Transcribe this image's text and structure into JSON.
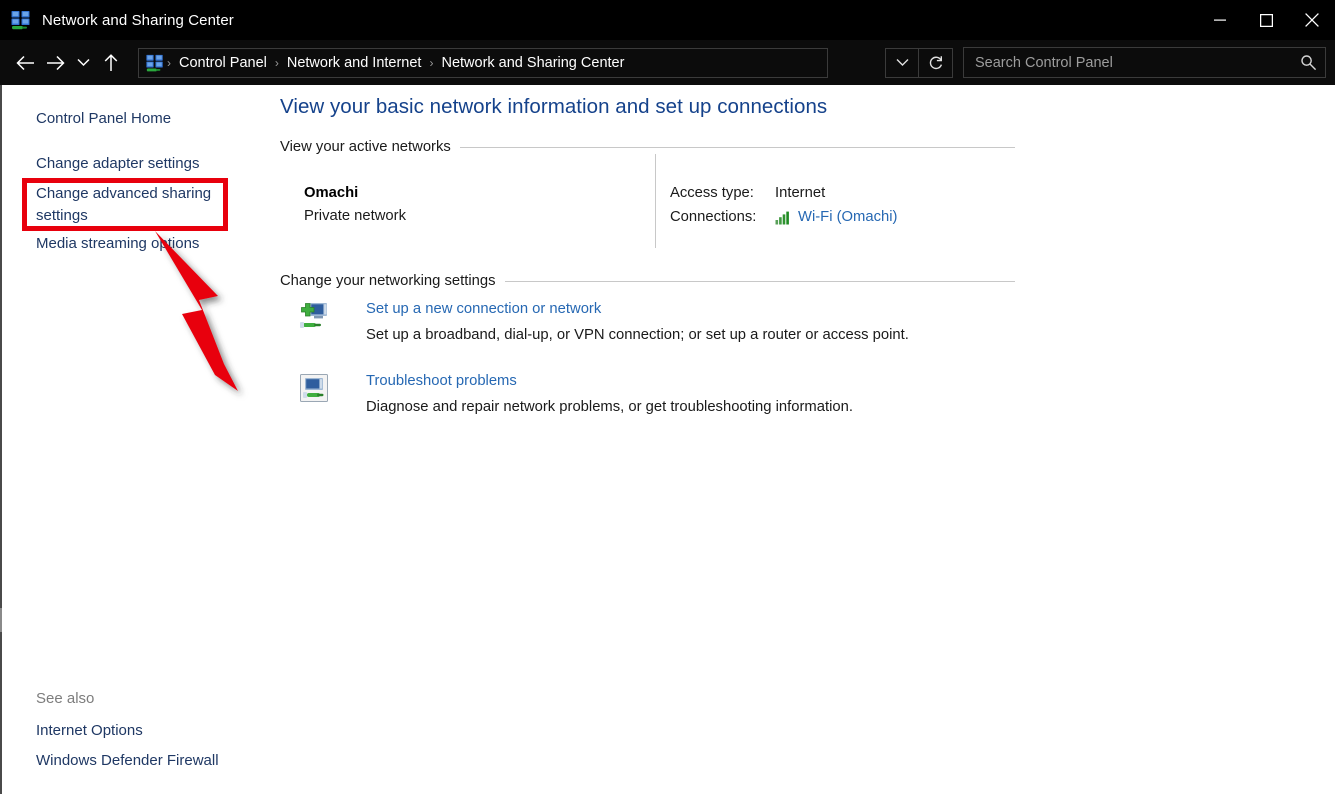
{
  "window": {
    "title": "Network and Sharing Center",
    "icon": "network-computers-icon",
    "controls": {
      "minimize": "minimize-icon",
      "maximize": "maximize-icon",
      "close": "close-icon"
    }
  },
  "addressbar": {
    "back": "back-arrow-icon",
    "forward": "forward-arrow-icon",
    "recent": "chevron-down-icon",
    "up": "up-arrow-icon",
    "crumb_icon": "control-panel-icon",
    "breadcrumbs": [
      "Control Panel",
      "Network and Internet",
      "Network and Sharing Center"
    ],
    "separator": "›",
    "history_dropdown": "chevron-down-icon",
    "refresh": "refresh-icon",
    "search": {
      "placeholder": "Search Control Panel",
      "value": "",
      "icon": "search-icon"
    }
  },
  "sidebar": {
    "items": [
      {
        "label": "Control Panel Home"
      },
      {
        "label": "Change adapter settings"
      },
      {
        "label": "Change advanced sharing settings"
      },
      {
        "label": "Media streaming options"
      }
    ],
    "see_also": {
      "label": "See also",
      "items": [
        {
          "label": "Internet Options"
        },
        {
          "label": "Windows Defender Firewall"
        }
      ]
    }
  },
  "main": {
    "page_title": "View your basic network information and set up connections",
    "active_networks": {
      "heading": "View your active networks",
      "network": {
        "name": "Omachi",
        "type": "Private network",
        "access_type_key": "Access type:",
        "access_type_value": "Internet",
        "connections_key": "Connections:",
        "connections_value": "Wi-Fi (Omachi)",
        "connections_icon": "wifi-signal-bars-icon"
      }
    },
    "networking_settings": {
      "heading": "Change your networking settings",
      "tasks": [
        {
          "icon": "new-connection-icon",
          "link": "Set up a new connection or network",
          "description": "Set up a broadband, dial-up, or VPN connection; or set up a router or access point."
        },
        {
          "icon": "troubleshoot-icon",
          "link": "Troubleshoot problems",
          "description": "Diagnose and repair network problems, or get troubleshooting information."
        }
      ]
    }
  },
  "annotations": {
    "highlight_color": "#e8000d",
    "highlight_target": "Change advanced sharing settings",
    "arrow": "red-pointer-arrow"
  },
  "colors": {
    "titlebar_bg": "#000000",
    "addressbar_bg": "#0c0c0c",
    "link": "#2668b3",
    "sidebar_link": "#1f3864",
    "heading": "#15428b",
    "annotation": "#e8000d"
  }
}
